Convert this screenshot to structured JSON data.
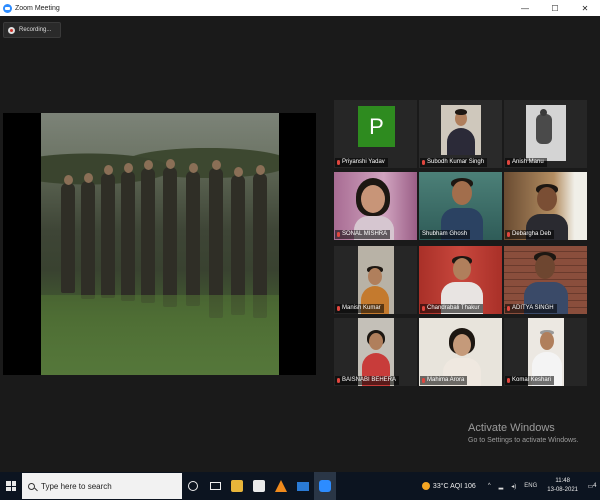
{
  "window": {
    "title": "Zoom Meeting",
    "controls": [
      "—",
      "☐",
      "✕"
    ]
  },
  "recording": {
    "label": "Recording..."
  },
  "participants": [
    {
      "name": "Priyanshi Yadav",
      "avatar_letter": "P"
    },
    {
      "name": "Subodh Kumar Singh"
    },
    {
      "name": "Anish Manu"
    },
    {
      "name": "SONAL MISHRA"
    },
    {
      "name": "Shubham Ghosh",
      "active": true
    },
    {
      "name": "Debargha Deb"
    },
    {
      "name": "Manish Kumar"
    },
    {
      "name": "Chandrabali Thakur"
    },
    {
      "name": "ADITYA SINGH"
    },
    {
      "name": "BAISNABI BEHERA"
    },
    {
      "name": "Mahima Arora"
    },
    {
      "name": "Komal Keshari"
    }
  ],
  "watermark": {
    "heading": "Activate Windows",
    "subtext": "Go to Settings to activate Windows."
  },
  "taskbar": {
    "search_placeholder": "Type here to search",
    "pinned": [
      "cortana-icon",
      "task-view-icon",
      "file-explorer-icon",
      "store-icon",
      "vlc-icon",
      "mail-icon",
      "zoom-icon"
    ],
    "weather": "33°C AQI 106",
    "language": "ENG",
    "time": "11:48",
    "date": "13-08-2021",
    "notification_count": "4"
  },
  "colors": {
    "accent": "#2d8cff",
    "active_border": "#c7e05a",
    "avatar_bg": "#2e8b1f",
    "muted_mic": "#e0463e"
  }
}
